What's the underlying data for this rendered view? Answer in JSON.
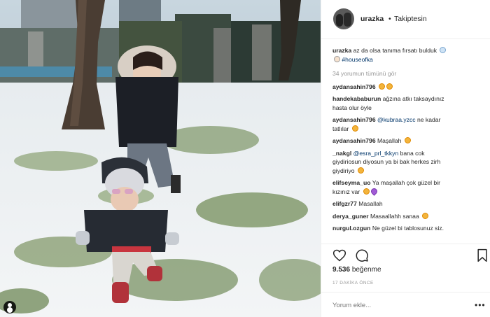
{
  "header": {
    "username": "urazka",
    "separator": "•",
    "follow_status": "Takiptesin"
  },
  "caption": {
    "username": "urazka",
    "text": "az da olsa tanıma fırsatı bulduk",
    "hashtag": "#houseofka"
  },
  "view_all_comments": "34 yorumun tümünü gör",
  "comments": [
    {
      "user": "aydansahin796",
      "text": "",
      "emojis": [
        "smile-emoji",
        "smile-emoji"
      ]
    },
    {
      "user": "handekababurun",
      "text": "ağzına atkı taksaydınız",
      "text2": "hasta olur öyle"
    },
    {
      "user": "aydansahin796",
      "mention": "@kubraa.yzcc",
      "text": "ne kadar",
      "text2": "tatlılar",
      "emojis2": [
        "smile-emoji"
      ]
    },
    {
      "user": "aydansahin796",
      "text": "Maşallah",
      "emojis": [
        "smile-emoji"
      ]
    },
    {
      "user": "_nakgl",
      "mention": "@esra_prl_tkkyn",
      "text": "bana cok",
      "text2": "giydiriosun diyosun ya bi bak herkes zirh",
      "text3": "giydiriyo",
      "emojis3": [
        "smile-emoji"
      ]
    },
    {
      "user": "elifseyma_uo",
      "text": "Ya maşallah çok güzel bir",
      "text2": "kızınız var",
      "emojis2": [
        "smile-emoji",
        "heart-emoji"
      ]
    },
    {
      "user": "elifgzr77",
      "text": "Masallah"
    },
    {
      "user": "derya_guner",
      "text": "Masaallahh sanaa",
      "emojis": [
        "smile-emoji"
      ]
    },
    {
      "user": "nurgul.ozgun",
      "text": "Ne güzel bi tablosunuz siz."
    }
  ],
  "likes": {
    "count": "9.536",
    "label": "beğenme"
  },
  "time_ago": "17 DAKİKA ÖNCE",
  "add_comment": {
    "placeholder": "Yorum ekle..."
  },
  "more_label": "•••",
  "colors": {
    "text": "#262626",
    "muted": "#999999",
    "link": "#003569",
    "border": "#efefef"
  }
}
